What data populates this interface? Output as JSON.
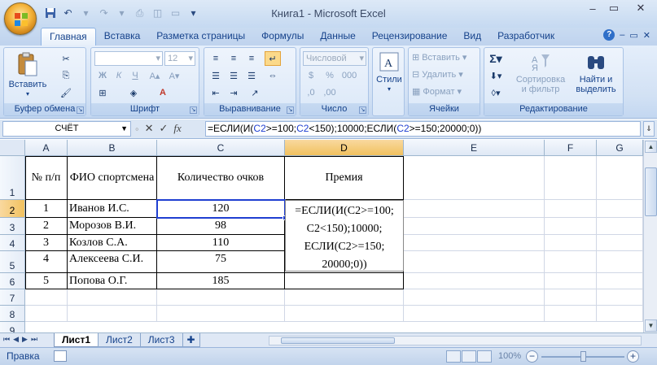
{
  "window": {
    "title": "Книга1 - Microsoft Excel"
  },
  "tabs": [
    "Главная",
    "Вставка",
    "Разметка страницы",
    "Формулы",
    "Данные",
    "Рецензирование",
    "Вид",
    "Разработчик"
  ],
  "ribbon": {
    "clipboard": {
      "label": "Буфер обмена",
      "paste": "Вставить"
    },
    "font": {
      "label": "Шрифт",
      "size": "12",
      "bold": "Ж",
      "italic": "К",
      "underline": "Ч"
    },
    "alignment": {
      "label": "Выравнивание"
    },
    "number": {
      "label": "Число",
      "format": "Числовой"
    },
    "styles": {
      "label": "Стили"
    },
    "cells": {
      "label": "Ячейки",
      "insert": "Вставить",
      "delete": "Удалить",
      "format": "Формат"
    },
    "editing": {
      "label": "Редактирование",
      "sort_line1": "Сортировка",
      "sort_line2": "и фильтр",
      "find_line1": "Найти и",
      "find_line2": "выделить"
    }
  },
  "formula_bar": {
    "name_box": "СЧЁТ",
    "fx": "fx",
    "formula_parts": [
      "=ЕСЛИ(И(",
      "C2",
      ">=100;",
      "C2",
      "<150);10000;ЕСЛИ(",
      "C2",
      ">=150;20000;0))"
    ]
  },
  "columns": [
    "A",
    "B",
    "C",
    "D",
    "E",
    "F",
    "G"
  ],
  "rows": [
    "1",
    "2",
    "3",
    "4",
    "5",
    "6",
    "7",
    "8",
    "9"
  ],
  "table": {
    "headers": [
      "№ п/п",
      "ФИО спортсмена",
      "Количество очков",
      "Премия"
    ],
    "rows": [
      [
        "1",
        "Иванов И.С.",
        "120"
      ],
      [
        "2",
        "Морозов В.И.",
        "98"
      ],
      [
        "3",
        "Козлов С.А.",
        "110"
      ],
      [
        "4",
        "Алексеева С.И.",
        "75"
      ],
      [
        "5",
        "Попова О.Г.",
        "185"
      ]
    ],
    "edit_text": [
      "=ЕСЛИ(И(С2>=100;",
      "С2<150);10000;",
      "ЕСЛИ(С2>=150;",
      "20000;0))"
    ]
  },
  "sheets": [
    "Лист1",
    "Лист2",
    "Лист3"
  ],
  "status": {
    "mode": "Правка",
    "zoom": "100%"
  },
  "colors": {
    "accent": "#15428b",
    "ref": "#1f3fd1",
    "selected_header": "#f1c15f"
  }
}
